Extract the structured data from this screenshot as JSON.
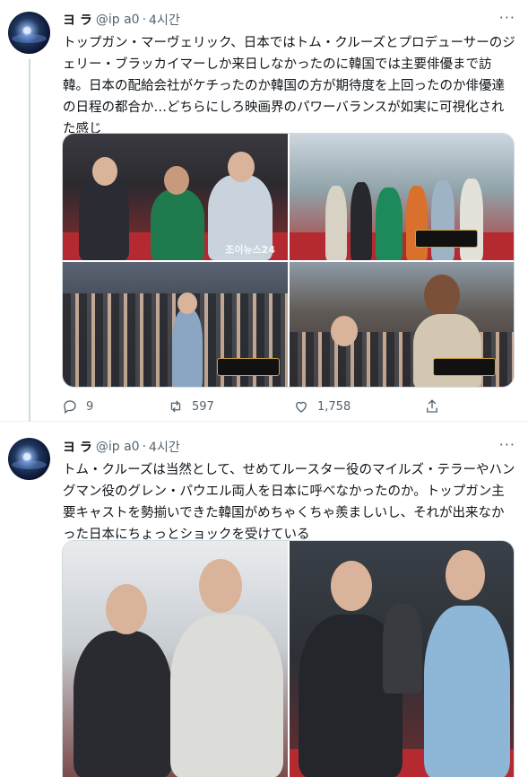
{
  "tweets": [
    {
      "author": "ヨ   ラ",
      "handle": "@ip  a0",
      "time": "4시간",
      "text": "トップガン・マーヴェリック、日本ではトム・クルーズとプロデューサーのジェリー・ブラッカイマーしか来日しなかったのに韓国では主要俳優まで訪韓。日本の配給会社がケチったのか韓国の方が期待度を上回ったのか俳優達の日程の都合か…どちらにしろ映画界のパワーバランスが如実に可視化された感じ",
      "images": [
        "red-carpet-trio",
        "red-carpet-group",
        "crowd-fan-meet",
        "selfie-with-fans"
      ],
      "watermark": "조이뉴스24",
      "replies": "9",
      "retweets": "597",
      "likes": "1,758"
    },
    {
      "author": "ヨ   ラ",
      "handle": "@ip  a0",
      "time": "4시간",
      "text": "トム・クルーズは当然として、せめてルースター役のマイルズ・テラーやハングマン役のグレン・パウエル両人を日本に呼べなかったのか。トップガン主要キャストを勢揃いできた韓国がめちゃくちゃ羨ましいし、それが出来なかった日本にちょっとショックを受けている",
      "images": [
        "finger-heart-duo",
        "handshake-red-carpet"
      ]
    }
  ],
  "ui": {
    "more_label": "···",
    "separator": "·"
  },
  "colors": {
    "text": "#0f1419",
    "secondary": "#536471",
    "border": "#cfd9de",
    "carpet_red": "#b52a30"
  }
}
